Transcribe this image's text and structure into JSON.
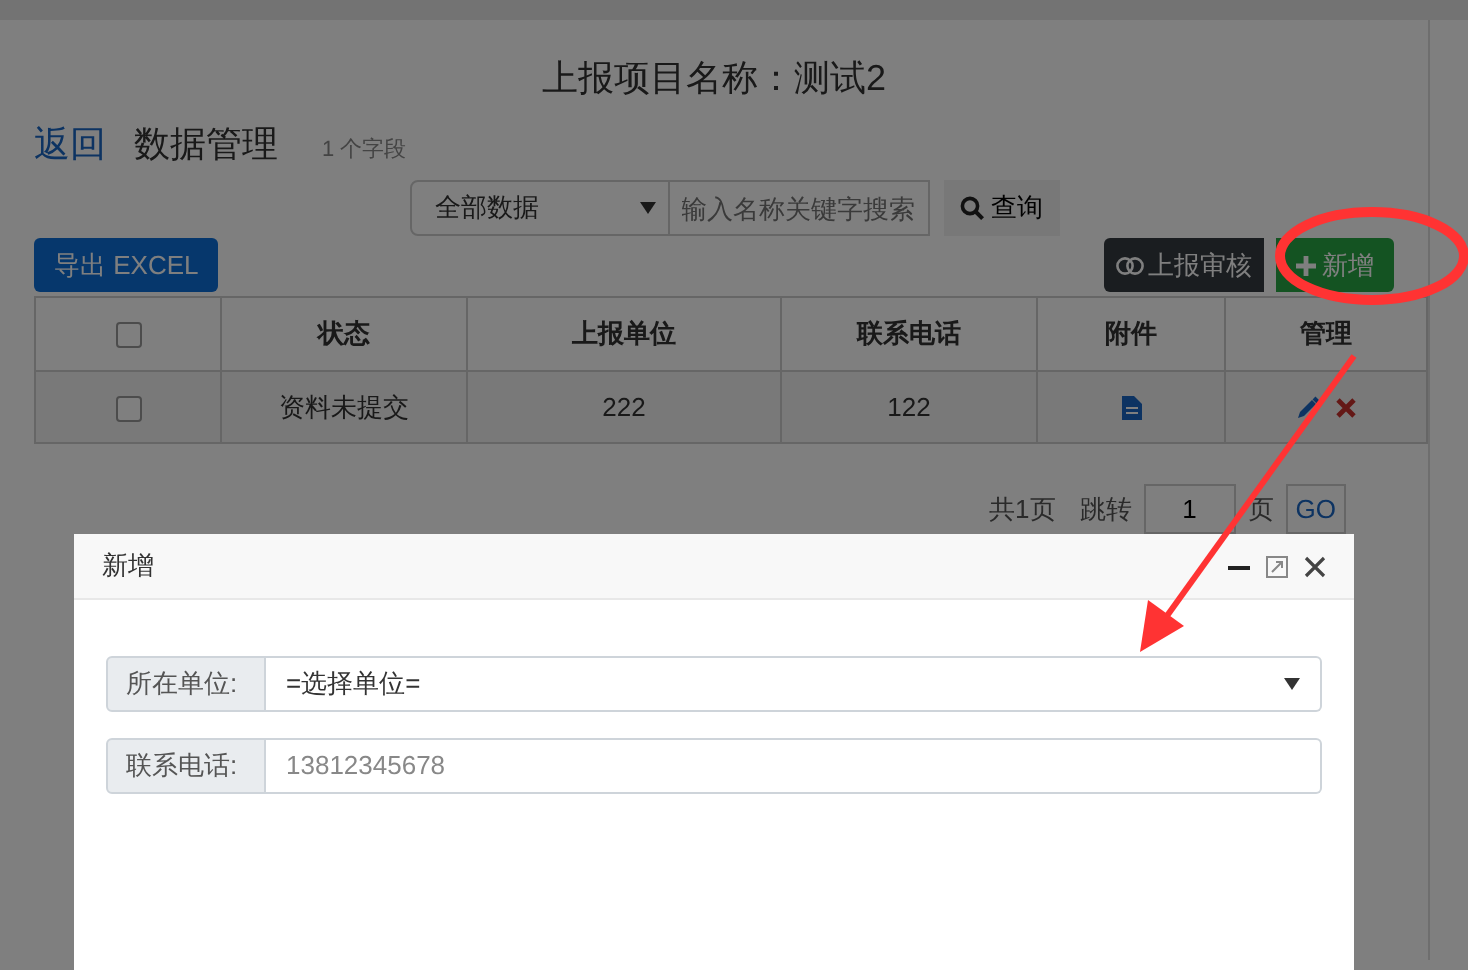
{
  "page_title": "上报项目名称：测试2",
  "header": {
    "back_link": "返回",
    "heading": "数据管理",
    "field_count": "1 个字段"
  },
  "filter": {
    "scope": "全部数据",
    "search_placeholder": "输入名称关键字搜索",
    "search_button": "查询"
  },
  "toolbar": {
    "export_button": "导出 EXCEL",
    "audit_button": "上报审核",
    "add_button": "新增"
  },
  "table": {
    "select_all_checked": false,
    "columns": [
      "状态",
      "上报单位",
      "联系电话",
      "附件",
      "管理"
    ],
    "rows": [
      {
        "checked": false,
        "status": "资料未提交",
        "unit": "222",
        "phone": "122"
      }
    ]
  },
  "pagination": {
    "total": "共1页",
    "jump_label": "跳转",
    "page_value": "1",
    "page_suffix": "页",
    "go_button": "GO"
  },
  "modal": {
    "title": "新增",
    "fields": [
      {
        "kind": "select",
        "label": "所在单位:",
        "value": "=选择单位="
      },
      {
        "kind": "text",
        "label": "联系电话:",
        "placeholder": "13812345678"
      }
    ]
  }
}
